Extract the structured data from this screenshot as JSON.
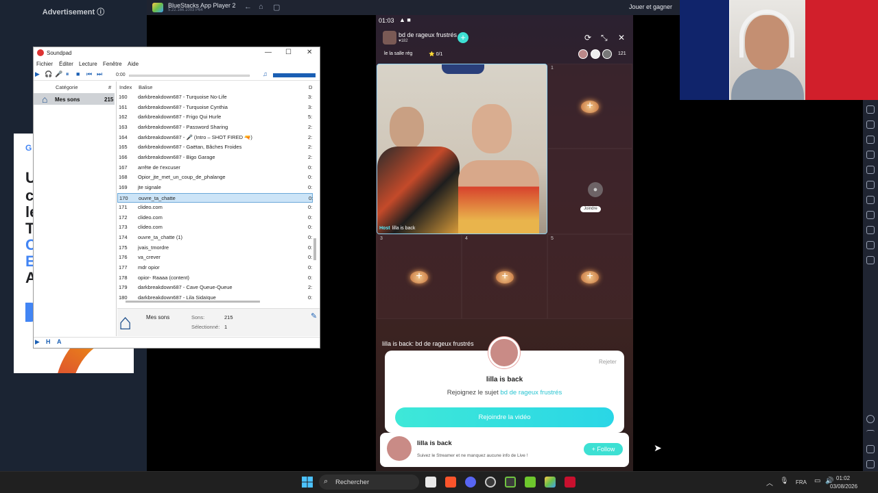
{
  "advertisement": {
    "label": "Advertisement ⓘ",
    "letters": [
      "G",
      "U",
      "c",
      "le",
      "T",
      "C",
      "E",
      "A"
    ]
  },
  "bluestacks": {
    "title": "BlueStacks App Player 2",
    "version": "5.22.166.1003 P64",
    "play_label": "Jouer et gagner",
    "nav": [
      "←",
      "⌂",
      "▢"
    ]
  },
  "status_bar": {
    "time": "01:03",
    "icons": "▲ ■"
  },
  "room": {
    "title": "bd de rageux frustrés",
    "subtitle": "♥182",
    "add_icon": "+",
    "tag_left": "le la salle rég",
    "tag_right": "⭐ 0/1",
    "viewer_count": "121",
    "top_icons": [
      "⟳",
      "⤡",
      "✕"
    ]
  },
  "slots": {
    "host_label": "lilla is back",
    "host_badge": "Host",
    "numbers": [
      "1",
      "3",
      "4",
      "5"
    ],
    "plus": "+",
    "join_label": "Joindre"
  },
  "chat": {
    "line": "lilla is back: bd de rageux frustrés"
  },
  "invite": {
    "reject": "Rejeter",
    "name": "lilla is back",
    "text_prefix": "Rejoignez le sujet",
    "topic": "bd de rageux frustrés",
    "button": "Rejoindre la vidéo"
  },
  "follow_card": {
    "name": "lilla is back",
    "description": "Suivez le Streamer et ne manquez aucune info de Live !",
    "button": "+ Follow"
  },
  "soundpad": {
    "title": "Soundpad",
    "window_buttons": [
      "—",
      "☐",
      "✕"
    ],
    "menu": [
      "Fichier",
      "Éditer",
      "Lecture",
      "Fenêtre",
      "Aide"
    ],
    "toolbar_buttons": [
      "▶",
      "🎧",
      "🎤",
      "⏸",
      "■",
      "⏮",
      "⏭"
    ],
    "time": "0:00",
    "category_header": "Catégorie",
    "category_count_header": "#",
    "category": {
      "label": "Mes sons",
      "count": "215"
    },
    "list_header_index": "Index",
    "list_header_tag": "Balise",
    "list_header_duration": "D",
    "rows": [
      {
        "index": "160",
        "tag": "darkbreakdown687 - Turquoise No-Life",
        "dur": "3:"
      },
      {
        "index": "161",
        "tag": "darkbreakdown687 - Turquoise Cynthia",
        "dur": "3:"
      },
      {
        "index": "162",
        "tag": "darkbreakdown687 - Frigo Qui Hurle",
        "dur": "5:"
      },
      {
        "index": "163",
        "tag": "darkbreakdown687 - Password Sharing",
        "dur": "2:"
      },
      {
        "index": "164",
        "tag": "darkbreakdown687 - 🎤 (Intro – SHOT FIRED 🔫)",
        "dur": "2:"
      },
      {
        "index": "165",
        "tag": "darkbreakdown687 - Gaëtan, Bâches Froides",
        "dur": "2:"
      },
      {
        "index": "166",
        "tag": "darkbreakdown687 - Bigo Garage",
        "dur": "2:"
      },
      {
        "index": "167",
        "tag": "arrête de t'excuser",
        "dur": "0:"
      },
      {
        "index": "168",
        "tag": "Opior_jte_met_un_coup_de_phalange",
        "dur": "0:"
      },
      {
        "index": "169",
        "tag": "jte signale",
        "dur": "0:"
      },
      {
        "index": "170",
        "tag": "ouvre_ta_chatte",
        "dur": "0:"
      },
      {
        "index": "171",
        "tag": "clideo.com",
        "dur": "0:"
      },
      {
        "index": "172",
        "tag": "clideo.com",
        "dur": "0:"
      },
      {
        "index": "173",
        "tag": "clideo.com",
        "dur": "0:"
      },
      {
        "index": "174",
        "tag": "ouvre_ta_chatte (1)",
        "dur": "0:"
      },
      {
        "index": "175",
        "tag": "jvais_tmordre",
        "dur": "0:"
      },
      {
        "index": "176",
        "tag": "va_crever",
        "dur": "0:"
      },
      {
        "index": "177",
        "tag": "mdr opior",
        "dur": "0:"
      },
      {
        "index": "178",
        "tag": "opior- Raaaa (content)",
        "dur": "0:"
      },
      {
        "index": "179",
        "tag": "darkbreakdown687 - Cave Queue-Queue",
        "dur": "2:"
      },
      {
        "index": "180",
        "tag": "darkbreakdown687 - Lila Sidaïque",
        "dur": "0:"
      }
    ],
    "selected_index": 10,
    "info": {
      "name": "Mes sons",
      "sons_label": "Sons:",
      "sons": "215",
      "selected_label": "Sélectionné:",
      "selected": "1"
    },
    "bottom_buttons": [
      "▶",
      "H",
      "A"
    ]
  },
  "taskbar": {
    "search_label": "Rechercher",
    "search_icon": "⌕",
    "language": "FRA",
    "time": "01:02",
    "date": "03/08/2026",
    "tray_up": "︿",
    "tray_mic": "🎙",
    "tray_net": "▭",
    "tray_vol": "🔊"
  },
  "colors": {
    "accent_teal": "#3de0d3",
    "soundpad_blue": "#1a5fb4",
    "selection": "#cce4f7"
  }
}
